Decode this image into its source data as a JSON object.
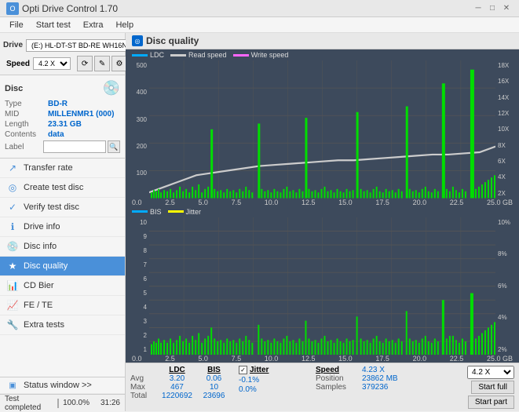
{
  "titlebar": {
    "title": "Opti Drive Control 1.70",
    "minimize": "─",
    "maximize": "□",
    "close": "✕"
  },
  "menubar": {
    "items": [
      "File",
      "Start test",
      "Extra",
      "Help"
    ]
  },
  "drive": {
    "label": "Drive",
    "drive_value": "(E:)  HL-DT-ST BD-RE  WH16NS48 1.D3",
    "speed_label": "Speed",
    "speed_value": "4.2 X"
  },
  "disc": {
    "title": "Disc",
    "type_label": "Type",
    "type_value": "BD-R",
    "mid_label": "MID",
    "mid_value": "MILLENMR1 (000)",
    "length_label": "Length",
    "length_value": "23.31 GB",
    "contents_label": "Contents",
    "contents_value": "data",
    "label_label": "Label",
    "label_placeholder": ""
  },
  "nav": {
    "items": [
      {
        "id": "transfer-rate",
        "label": "Transfer rate",
        "icon": "↗"
      },
      {
        "id": "create-test-disc",
        "label": "Create test disc",
        "icon": "◎"
      },
      {
        "id": "verify-test-disc",
        "label": "Verify test disc",
        "icon": "✓"
      },
      {
        "id": "drive-info",
        "label": "Drive info",
        "icon": "ℹ"
      },
      {
        "id": "disc-info",
        "label": "Disc info",
        "icon": "💿"
      },
      {
        "id": "disc-quality",
        "label": "Disc quality",
        "icon": "★",
        "active": true
      },
      {
        "id": "cd-bier",
        "label": "CD Bier",
        "icon": "📊"
      },
      {
        "id": "fe-te",
        "label": "FE / TE",
        "icon": "📈"
      },
      {
        "id": "extra-tests",
        "label": "Extra tests",
        "icon": "🔧"
      }
    ]
  },
  "status_window": {
    "label": "Status window >>",
    "icon": "▣"
  },
  "disc_quality": {
    "title": "Disc quality",
    "legend_top": {
      "ldc": "LDC",
      "read": "Read speed",
      "write": "Write speed"
    },
    "legend_bottom": {
      "bis": "BIS",
      "jitter": "Jitter"
    },
    "y_left_top": [
      "500",
      "400",
      "300",
      "200",
      "100"
    ],
    "y_right_top": [
      "18X",
      "16X",
      "14X",
      "12X",
      "10X",
      "8X",
      "6X",
      "4X",
      "2X"
    ],
    "x_axis": [
      "0.0",
      "2.5",
      "5.0",
      "7.5",
      "10.0",
      "12.5",
      "15.0",
      "17.5",
      "20.0",
      "22.5",
      "25.0 GB"
    ],
    "y_left_bottom": [
      "10",
      "9",
      "8",
      "7",
      "6",
      "5",
      "4",
      "3",
      "2",
      "1"
    ],
    "y_right_bottom": [
      "10%",
      "8%",
      "6%",
      "4%",
      "2%"
    ]
  },
  "stats": {
    "headers": [
      "LDC",
      "BIS",
      "",
      "Jitter",
      "Speed",
      ""
    ],
    "avg_label": "Avg",
    "avg_ldc": "3.20",
    "avg_bis": "0.06",
    "avg_jitter": "-0.1%",
    "avg_speed": "",
    "max_label": "Max",
    "max_ldc": "467",
    "max_bis": "10",
    "max_jitter": "0.0%",
    "max_speed": "",
    "total_label": "Total",
    "total_ldc": "1220692",
    "total_bis": "23696",
    "total_jitter": "",
    "jitter_checked": true,
    "jitter_label": "Jitter",
    "speed_label": "Speed",
    "speed_val": "4.23 X",
    "speed_select": "4.2 X",
    "position_label": "Position",
    "position_val": "23862 MB",
    "samples_label": "Samples",
    "samples_val": "379236",
    "start_full": "Start full",
    "start_part": "Start part"
  },
  "progress": {
    "status_text": "Test completed",
    "percent": "100.0%",
    "percent_num": 100,
    "time": "31:26"
  }
}
